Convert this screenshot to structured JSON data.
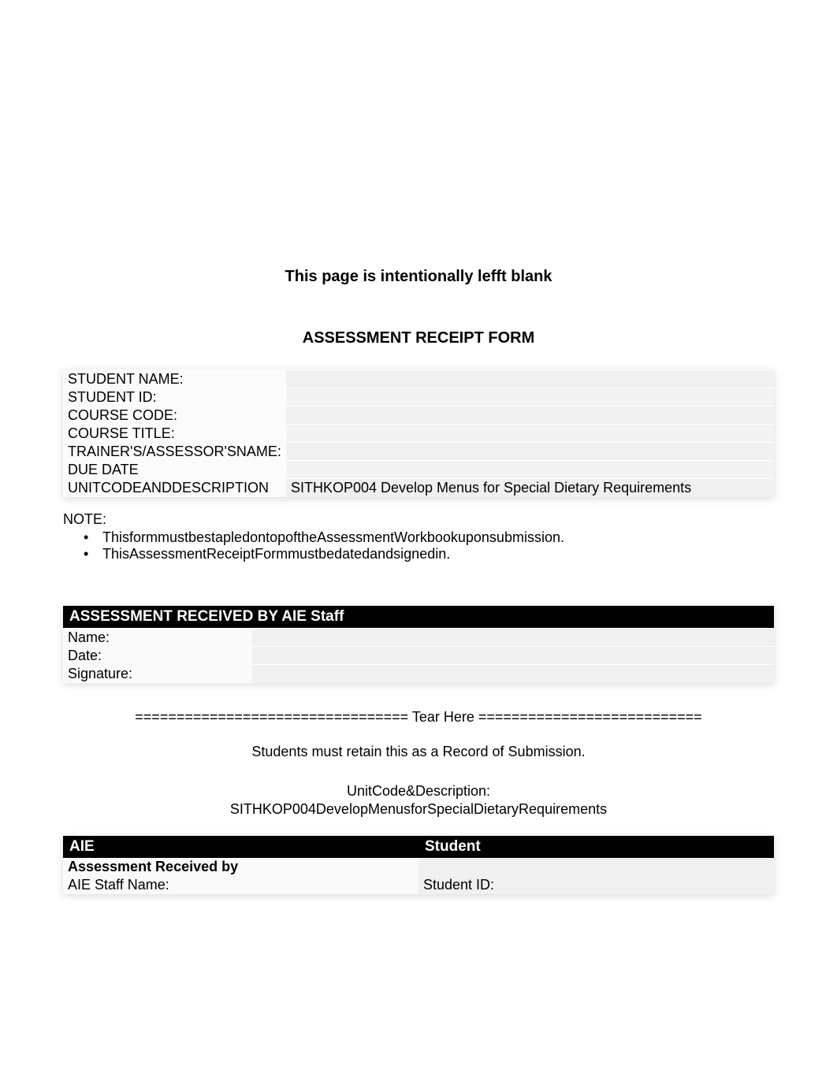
{
  "blank_notice": "This page is intentionally lefft blank",
  "form_title": "ASSESSMENT RECEIPT FORM",
  "fields": {
    "student_name": {
      "label": "STUDENT NAME:",
      "value": ""
    },
    "student_id": {
      "label": "STUDENT ID:",
      "value": ""
    },
    "course_code": {
      "label": "COURSE CODE:",
      "value": ""
    },
    "course_title": {
      "label": "COURSE TITLE:",
      "value": ""
    },
    "trainer_name": {
      "label": "TRAINER'S/ASSESSOR'SNAME:",
      "value": ""
    },
    "due_date": {
      "label": "DUE DATE",
      "value": ""
    },
    "unit_desc": {
      "label": "UNITCODEANDDESCRIPTION",
      "value": "SITHKOP004 Develop Menus for Special Dietary Requirements"
    }
  },
  "note_heading": "NOTE:",
  "notes": [
    "ThisformmustbestapledontopoftheAssessmentWorkbookuponsubmission.",
    "ThisAssessmentReceiptFormmustbedatedandsignedin."
  ],
  "received_header": "ASSESSMENT RECEIVED BY AIE Staff",
  "received_fields": {
    "name": {
      "label": "Name:",
      "value": ""
    },
    "date": {
      "label": "Date:",
      "value": ""
    },
    "signature": {
      "label": "Signature:",
      "value": ""
    }
  },
  "tear_line": "================================= Tear Here ===========================",
  "retain_notice": "Students must retain this as a Record of Submission.",
  "unit_desc_label": "UnitCode&Description:",
  "unit_desc_value": "SITHKOP004DevelopMenusforSpecialDietaryRequirements",
  "bottom_headers": {
    "left": "AIE",
    "right": "Student"
  },
  "bottom_rows": {
    "row1_left": "Assessment Received by",
    "row1_right": "",
    "row2_left": "AIE Staff Name:",
    "row2_right": "Student ID:"
  }
}
